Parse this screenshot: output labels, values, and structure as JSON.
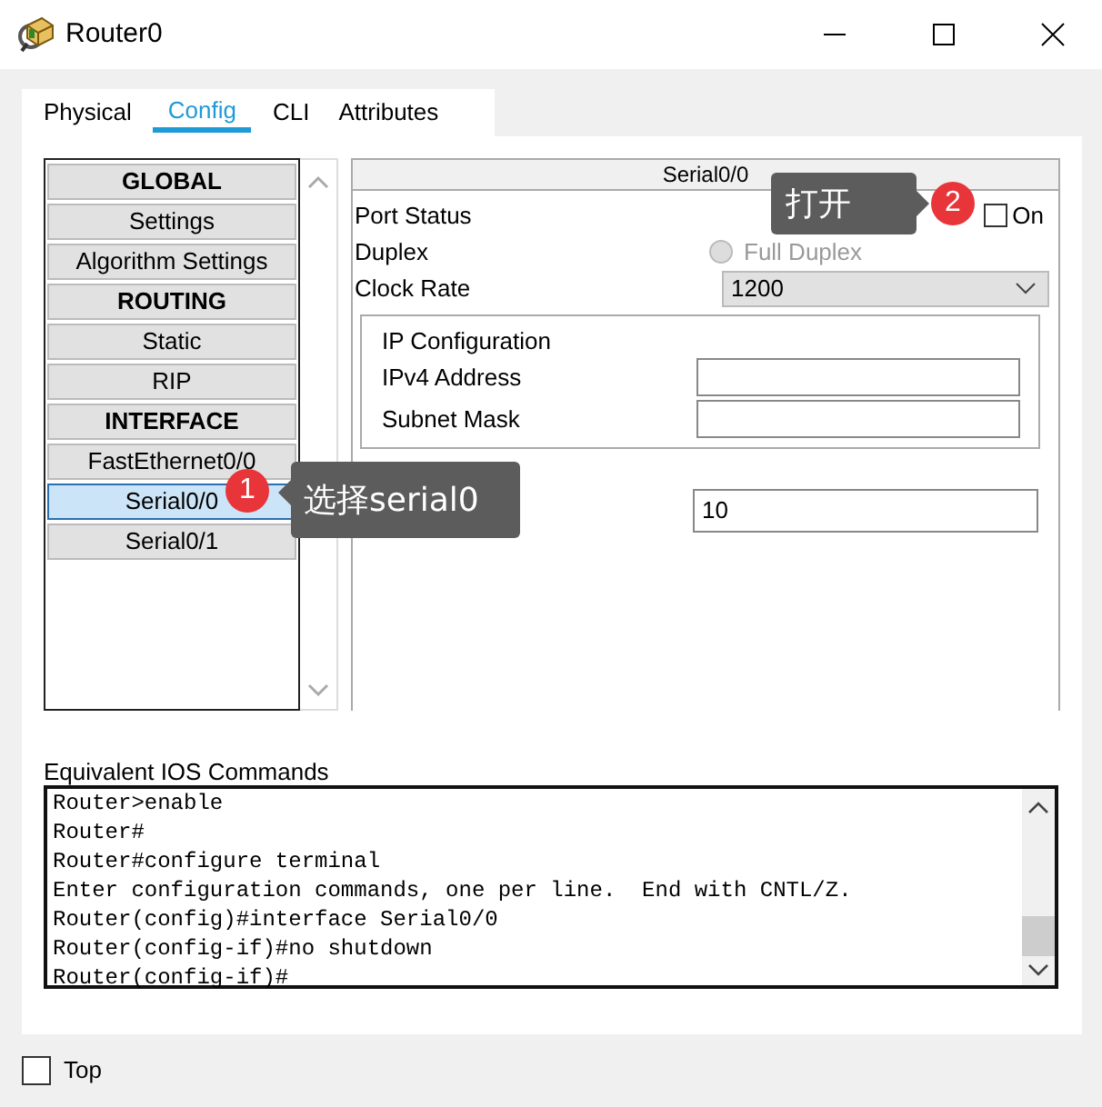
{
  "window": {
    "title": "Router0"
  },
  "tabs": [
    {
      "label": "Physical",
      "selected": false
    },
    {
      "label": "Config",
      "selected": true
    },
    {
      "label": "CLI",
      "selected": false
    },
    {
      "label": "Attributes",
      "selected": false
    }
  ],
  "sidebar": {
    "items": [
      {
        "label": "GLOBAL",
        "kind": "header",
        "selected": false
      },
      {
        "label": "Settings",
        "kind": "item",
        "selected": false
      },
      {
        "label": "Algorithm Settings",
        "kind": "item",
        "selected": false
      },
      {
        "label": "ROUTING",
        "kind": "header",
        "selected": false
      },
      {
        "label": "Static",
        "kind": "item",
        "selected": false
      },
      {
        "label": "RIP",
        "kind": "item",
        "selected": false
      },
      {
        "label": "INTERFACE",
        "kind": "header",
        "selected": false
      },
      {
        "label": "FastEthernet0/0",
        "kind": "item",
        "selected": false
      },
      {
        "label": "Serial0/0",
        "kind": "item",
        "selected": true
      },
      {
        "label": "Serial0/1",
        "kind": "item",
        "selected": false
      }
    ]
  },
  "panel": {
    "title": "Serial0/0",
    "port_status": {
      "label": "Port Status",
      "option": "On",
      "checked": false
    },
    "duplex": {
      "label": "Duplex",
      "option": "Full Duplex",
      "selected": false,
      "disabled": true
    },
    "clock_rate": {
      "label": "Clock Rate",
      "value": "1200"
    },
    "ip_configuration": {
      "title": "IP Configuration",
      "fields": [
        {
          "label": "IPv4 Address"
        },
        {
          "label": "Subnet Mask"
        }
      ]
    },
    "tx_ring": {
      "value": "10"
    }
  },
  "ios_commands": {
    "label": "Equivalent IOS Commands",
    "lines": [
      "Router>enable",
      "Router#",
      "Router#configure terminal",
      "Enter configuration commands, one per line.  End with CNTL/Z.",
      "Router(config)#interface Serial0/0",
      "Router(config-if)#no shutdown",
      "Router(config-if)#"
    ]
  },
  "top": {
    "label": "Top",
    "checked": false
  },
  "annotations": [
    {
      "number": "1",
      "text": "选择serial0"
    },
    {
      "number": "2",
      "text": "打开"
    }
  ]
}
